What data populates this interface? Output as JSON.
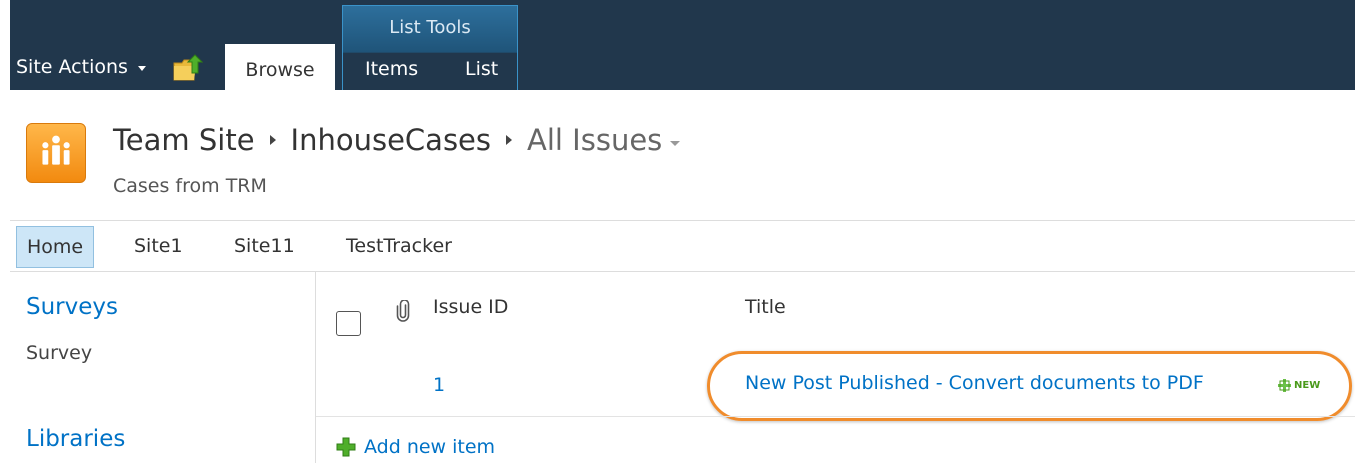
{
  "ribbon": {
    "site_actions_label": "Site Actions",
    "browse_tab_label": "Browse",
    "contextual_group_label": "List Tools",
    "items_tab_label": "Items",
    "list_tab_label": "List"
  },
  "title_area": {
    "breadcrumb": [
      "Team Site",
      "InhouseCases",
      "All Issues"
    ],
    "site_description": "Cases from TRM"
  },
  "top_nav": {
    "items": [
      "Home",
      "Site1",
      "Site11",
      "TestTracker"
    ],
    "selected": "Home"
  },
  "left_nav": {
    "sections": [
      {
        "heading": "Surveys",
        "links": [
          "Survey"
        ]
      },
      {
        "heading": "Libraries",
        "links": []
      }
    ]
  },
  "list_view": {
    "columns": [
      "Issue ID",
      "Title"
    ],
    "rows": [
      {
        "issue_id": "1",
        "title": "New Post Published - Convert documents to PDF",
        "badge": "NEW"
      }
    ],
    "add_new_label": "Add new item"
  },
  "colors": {
    "ribbon_bg": "#21374c",
    "link_blue": "#0072c6",
    "highlight_orange": "#f08c2c",
    "logo_orange": "#f28a10",
    "new_badge_green": "#4a9a1b"
  },
  "icons": [
    "caret-down-icon",
    "navigate-up-icon",
    "site-logo-icon",
    "breadcrumb-separator-icon",
    "attachment-icon",
    "new-sparkle-icon",
    "plus-icon"
  ]
}
